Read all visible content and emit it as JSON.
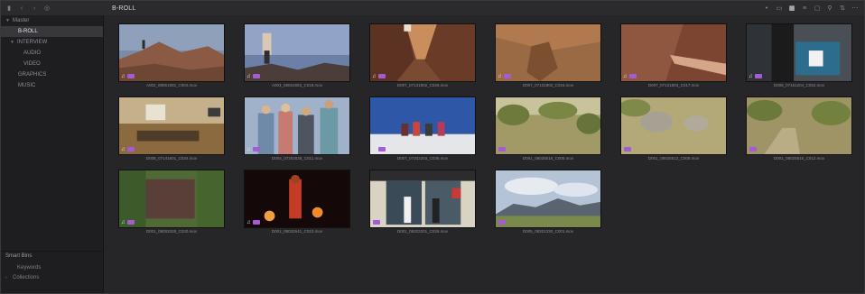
{
  "toolbar": {
    "bin_title": "B-ROLL",
    "left_icons": [
      "panel-toggle-icon",
      "back-icon",
      "forward-icon",
      "smart-bin-icon"
    ],
    "right_icons": [
      "dot-icon",
      "filmstrip-view-icon",
      "thumbnail-view-icon",
      "list-view-icon",
      "metadata-view-icon",
      "search-icon",
      "sort-icon",
      "options-icon"
    ]
  },
  "sidebar": {
    "master": "Master",
    "items": [
      {
        "label": "B-ROLL",
        "level": 1,
        "selected": true
      },
      {
        "label": "INTERVIEW",
        "level": 1,
        "expanded": true
      },
      {
        "label": "AUDIO",
        "level": 2
      },
      {
        "label": "VIDEO",
        "level": 2
      },
      {
        "label": "GRAPHICS",
        "level": 1
      },
      {
        "label": "MUSIC",
        "level": 1
      }
    ],
    "smart_bins": {
      "heading": "Smart Bins",
      "keywords": "Keywords",
      "collections": "Collections"
    }
  },
  "clips": [
    {
      "name": "A002_08061902_C004.mov",
      "audio": true,
      "scene": "desert-hiker"
    },
    {
      "name": "A003_08061903_C018.mov",
      "audio": true,
      "scene": "rock-climbers"
    },
    {
      "name": "D007_07131802_C026.mov",
      "audio": true,
      "scene": "canyon"
    },
    {
      "name": "D007_07131802_C016.mov",
      "audio": true,
      "scene": "dunes-rock"
    },
    {
      "name": "D007_07131803_C017.mov",
      "audio": true,
      "scene": "hand-rock"
    },
    {
      "name": "D008_07161204_C052.mov",
      "audio": true,
      "scene": "desk-monitor"
    },
    {
      "name": "D008_07141601_C034.mov",
      "audio": true,
      "scene": "room-interior"
    },
    {
      "name": "D004_07202028_C011.mov",
      "audio": true,
      "scene": "group-friends"
    },
    {
      "name": "D007_07202203_C036.mov",
      "audio": true,
      "scene": "snow-group"
    },
    {
      "name": "D001_08025518_C005.mov",
      "audio": false,
      "scene": "desert-shrubs"
    },
    {
      "name": "D001_08025513_C008.mov",
      "audio": false,
      "scene": "boulders"
    },
    {
      "name": "D001_08025516_C012.mov",
      "audio": false,
      "scene": "desert-trail"
    },
    {
      "name": "D001_08002028_C020.mov",
      "audio": true,
      "scene": "chalkboard"
    },
    {
      "name": "D001_08032641_C010.mov",
      "audio": true,
      "scene": "fire-dancer"
    },
    {
      "name": "D001_08202201_C026.mov",
      "audio": false,
      "scene": "storefront"
    },
    {
      "name": "D005_08201330_C001.mov",
      "audio": false,
      "scene": "mountain-sky"
    }
  ]
}
